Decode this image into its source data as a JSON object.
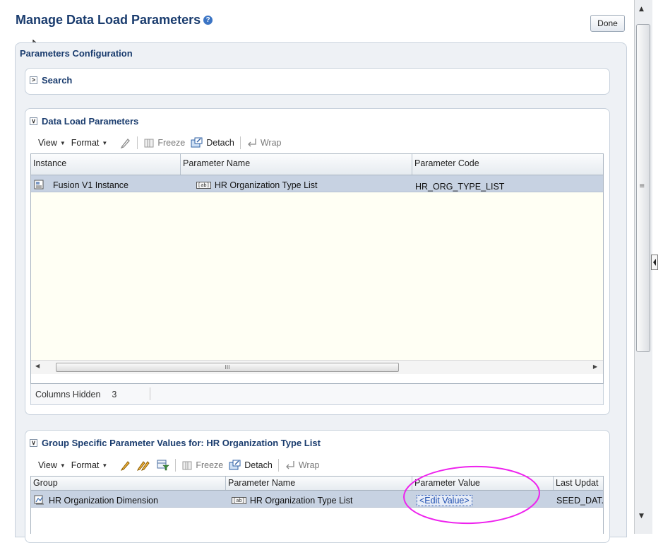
{
  "header": {
    "title": "Manage Data Load Parameters",
    "help_glyph": "?",
    "done_label": "Done"
  },
  "panel": {
    "title": "Parameters Configuration"
  },
  "search": {
    "title": "Search",
    "collapsed_glyph": ">"
  },
  "data_load": {
    "title": "Data Load Parameters",
    "expanded_glyph": "∨",
    "toolbar": {
      "view": "View",
      "format": "Format",
      "freeze": "Freeze",
      "detach": "Detach",
      "wrap": "Wrap"
    },
    "columns": [
      "Instance",
      "Parameter Name",
      "Parameter Code"
    ],
    "rows": [
      {
        "instance": "Fusion V1 Instance",
        "parameter_name": "HR Organization Type List",
        "parameter_code": "HR_ORG_TYPE_LIST"
      }
    ],
    "footer": {
      "columns_hidden_label": "Columns Hidden",
      "columns_hidden_count": "3"
    }
  },
  "group_specific": {
    "title": "Group Specific Parameter Values for: HR Organization Type List",
    "expanded_glyph": "∨",
    "toolbar": {
      "view": "View",
      "format": "Format",
      "freeze": "Freeze",
      "detach": "Detach",
      "wrap": "Wrap"
    },
    "columns": [
      "Group",
      "Parameter Name",
      "Parameter Value",
      "Last Updat"
    ],
    "rows": [
      {
        "group": "HR Organization Dimension",
        "parameter_name": "HR Organization Type List",
        "parameter_value": "<Edit Value>",
        "last_updated": "SEED_DAT."
      }
    ]
  },
  "icons": {
    "text_field_glyph": "[ab]",
    "scroll_grip": "≡",
    "hscroll_grip": "III"
  },
  "colors": {
    "title": "#1a3c6e",
    "selected_row": "#c7d2e2",
    "highlight_circle": "#ee22ee"
  }
}
